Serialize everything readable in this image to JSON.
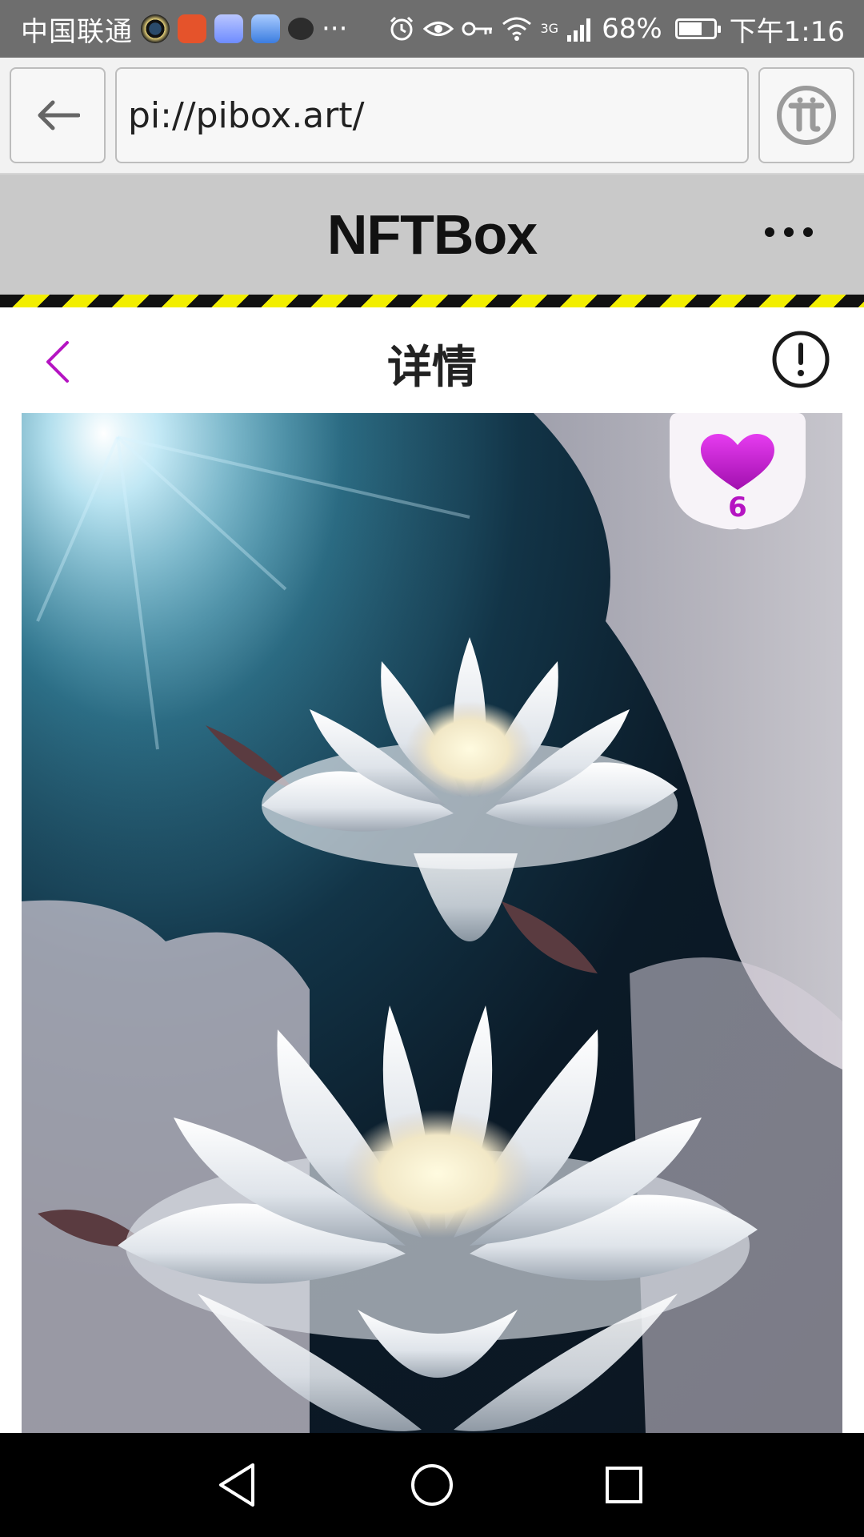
{
  "status_bar": {
    "carrier": "中国联通",
    "notification_more": "···",
    "network_type": "3G",
    "battery_percent": "68%",
    "battery_level": 0.68,
    "time": "下午1:16"
  },
  "browser": {
    "url": "pi://pibox.art/"
  },
  "app": {
    "title": "NFTBox"
  },
  "detail": {
    "title": "详情",
    "like_count": "6",
    "accent_color": "#b514c2"
  },
  "system_nav": {
    "back": "back-triangle-icon",
    "home": "home-circle-icon",
    "recents": "recents-square-icon"
  }
}
